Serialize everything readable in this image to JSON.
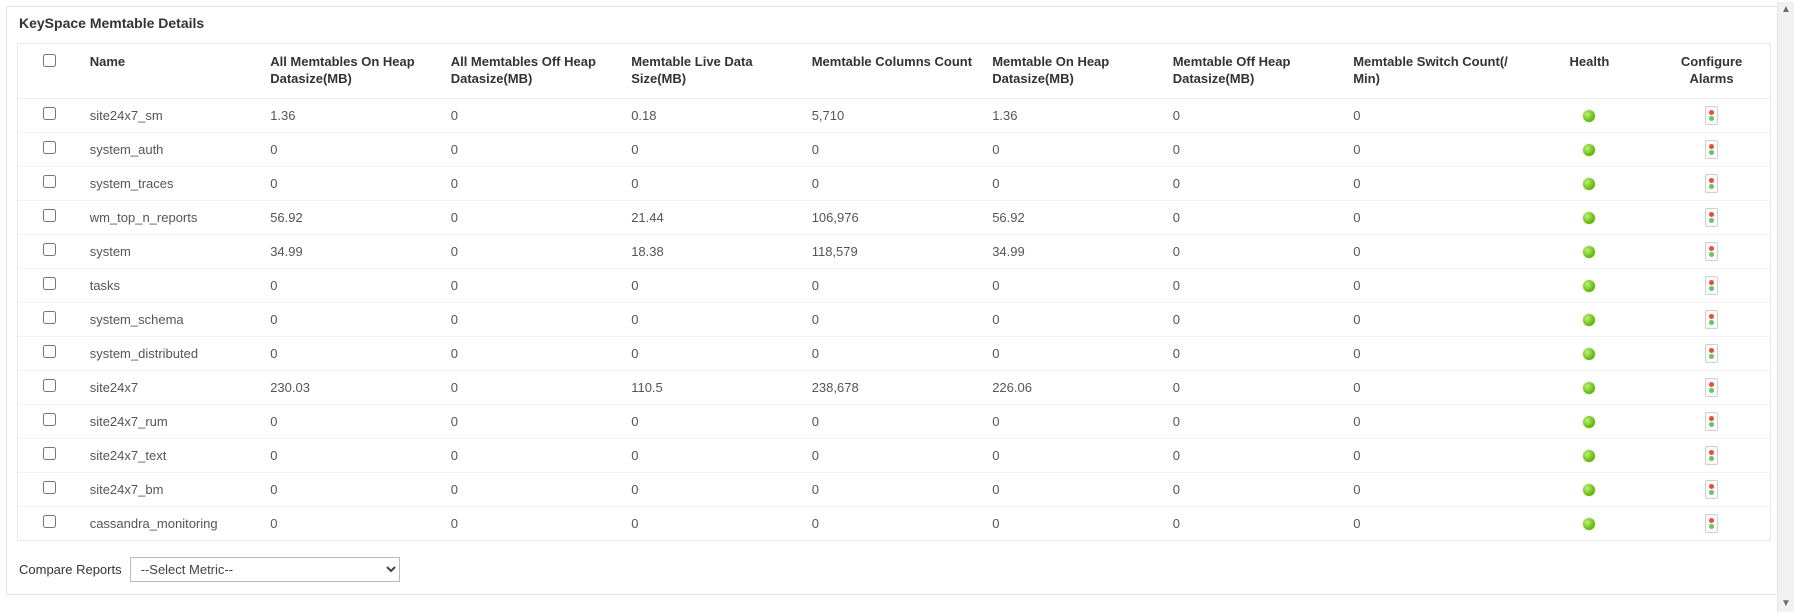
{
  "panel_title": "KeySpace Memtable Details",
  "columns": {
    "name": "Name",
    "on_heap": "All Memtables On Heap Datasize(MB)",
    "off_heap": "All Memtables Off Heap Datasize(MB)",
    "live_data": "Memtable Live Data Size(MB)",
    "cols_count": "Memtable Columns Count",
    "m_on_heap": "Memtable On Heap Datasize(MB)",
    "m_off_heap": "Memtable Off Heap Datasize(MB)",
    "switch_count": "Memtable Switch Count(/ Min)",
    "health": "Health",
    "alarms": "Configure Alarms"
  },
  "rows": [
    {
      "name": "site24x7_sm",
      "on_heap": "1.36",
      "off_heap": "0",
      "live_data": "0.18",
      "cols_count": "5,710",
      "m_on_heap": "1.36",
      "m_off_heap": "0",
      "switch_count": "0",
      "health": "green"
    },
    {
      "name": "system_auth",
      "on_heap": "0",
      "off_heap": "0",
      "live_data": "0",
      "cols_count": "0",
      "m_on_heap": "0",
      "m_off_heap": "0",
      "switch_count": "0",
      "health": "green"
    },
    {
      "name": "system_traces",
      "on_heap": "0",
      "off_heap": "0",
      "live_data": "0",
      "cols_count": "0",
      "m_on_heap": "0",
      "m_off_heap": "0",
      "switch_count": "0",
      "health": "green"
    },
    {
      "name": "wm_top_n_reports",
      "on_heap": "56.92",
      "off_heap": "0",
      "live_data": "21.44",
      "cols_count": "106,976",
      "m_on_heap": "56.92",
      "m_off_heap": "0",
      "switch_count": "0",
      "health": "green"
    },
    {
      "name": "system",
      "on_heap": "34.99",
      "off_heap": "0",
      "live_data": "18.38",
      "cols_count": "118,579",
      "m_on_heap": "34.99",
      "m_off_heap": "0",
      "switch_count": "0",
      "health": "green"
    },
    {
      "name": "tasks",
      "on_heap": "0",
      "off_heap": "0",
      "live_data": "0",
      "cols_count": "0",
      "m_on_heap": "0",
      "m_off_heap": "0",
      "switch_count": "0",
      "health": "green"
    },
    {
      "name": "system_schema",
      "on_heap": "0",
      "off_heap": "0",
      "live_data": "0",
      "cols_count": "0",
      "m_on_heap": "0",
      "m_off_heap": "0",
      "switch_count": "0",
      "health": "green"
    },
    {
      "name": "system_distributed",
      "on_heap": "0",
      "off_heap": "0",
      "live_data": "0",
      "cols_count": "0",
      "m_on_heap": "0",
      "m_off_heap": "0",
      "switch_count": "0",
      "health": "green"
    },
    {
      "name": "site24x7",
      "on_heap": "230.03",
      "off_heap": "0",
      "live_data": "110.5",
      "cols_count": "238,678",
      "m_on_heap": "226.06",
      "m_off_heap": "0",
      "switch_count": "0",
      "health": "green"
    },
    {
      "name": "site24x7_rum",
      "on_heap": "0",
      "off_heap": "0",
      "live_data": "0",
      "cols_count": "0",
      "m_on_heap": "0",
      "m_off_heap": "0",
      "switch_count": "0",
      "health": "green"
    },
    {
      "name": "site24x7_text",
      "on_heap": "0",
      "off_heap": "0",
      "live_data": "0",
      "cols_count": "0",
      "m_on_heap": "0",
      "m_off_heap": "0",
      "switch_count": "0",
      "health": "green"
    },
    {
      "name": "site24x7_bm",
      "on_heap": "0",
      "off_heap": "0",
      "live_data": "0",
      "cols_count": "0",
      "m_on_heap": "0",
      "m_off_heap": "0",
      "switch_count": "0",
      "health": "green"
    },
    {
      "name": "cassandra_monitoring",
      "on_heap": "0",
      "off_heap": "0",
      "live_data": "0",
      "cols_count": "0",
      "m_on_heap": "0",
      "m_off_heap": "0",
      "switch_count": "0",
      "health": "green"
    }
  ],
  "footer": {
    "compare_label": "Compare Reports",
    "select_placeholder": "--Select Metric--"
  }
}
